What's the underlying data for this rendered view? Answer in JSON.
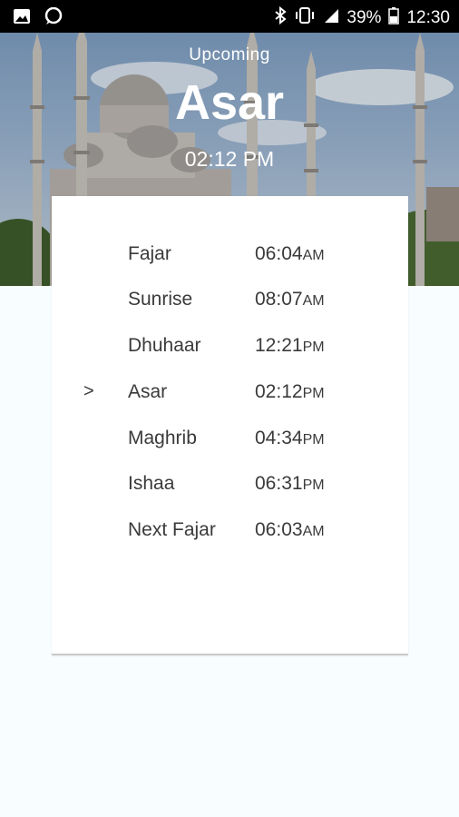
{
  "status_bar": {
    "battery_percent": "39%",
    "clock": "12:30",
    "icons": [
      "image-icon",
      "chat-icon",
      "bluetooth-icon",
      "vibrate-icon",
      "signal-icon",
      "battery-icon"
    ]
  },
  "hero": {
    "label": "Upcoming",
    "prayer": "Asar",
    "time": "02:12 PM"
  },
  "prayers": [
    {
      "marker": "",
      "name": "Fajar",
      "time": "06:04",
      "ampm": "AM"
    },
    {
      "marker": "",
      "name": "Sunrise",
      "time": "08:07",
      "ampm": "AM"
    },
    {
      "marker": "",
      "name": "Dhuhaar",
      "time": "12:21",
      "ampm": "PM"
    },
    {
      "marker": ">",
      "name": "Asar",
      "time": "02:12",
      "ampm": "PM"
    },
    {
      "marker": "",
      "name": "Maghrib",
      "time": "04:34",
      "ampm": "PM"
    },
    {
      "marker": "",
      "name": "Ishaa",
      "time": "06:31",
      "ampm": "PM"
    },
    {
      "marker": "",
      "name": "Next Fajar",
      "time": "06:03",
      "ampm": "AM"
    }
  ]
}
